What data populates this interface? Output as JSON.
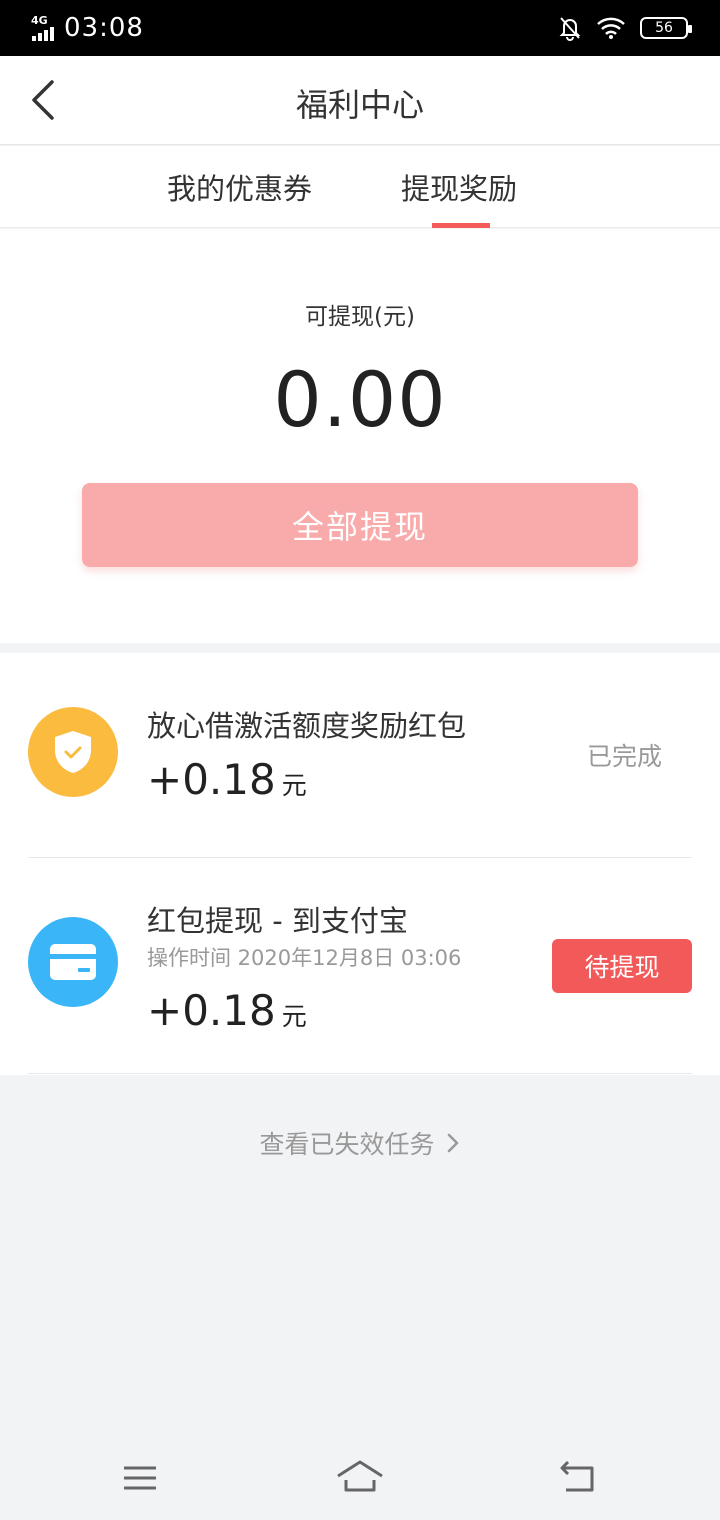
{
  "status_bar": {
    "network": "4G",
    "time": "03:08",
    "battery": "56"
  },
  "header": {
    "title": "福利中心"
  },
  "tabs": [
    {
      "label": "我的优惠券",
      "active": false
    },
    {
      "label": "提现奖励",
      "active": true
    }
  ],
  "balance": {
    "label": "可提现(元)",
    "value": "0.00",
    "button_label": "全部提现"
  },
  "rewards": [
    {
      "title": "放心借激活额度奖励红包",
      "amount": "+0.18",
      "unit": "元",
      "status": "已完成",
      "icon": "shield-check-icon"
    },
    {
      "title": "红包提现 - 到支付宝",
      "time": "操作时间 2020年12月8日 03:06",
      "amount": "+0.18",
      "unit": "元",
      "status": "待提现",
      "icon": "card-icon"
    }
  ],
  "footer": {
    "expired_link": "查看已失效任务"
  },
  "colors": {
    "accent_red": "#f25a5a",
    "button_pink": "#f9aaaa",
    "shield_yellow": "#fbbb3f",
    "card_blue": "#3ab5f7"
  }
}
